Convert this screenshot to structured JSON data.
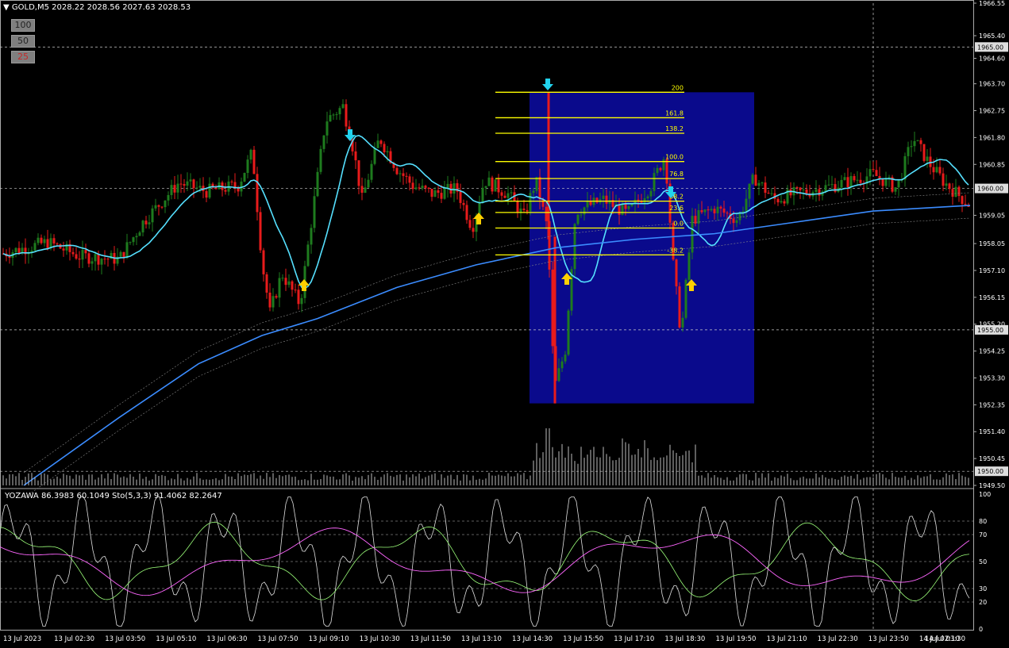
{
  "header": {
    "symbol": "GOLD,M5",
    "ohlc": "2028.22 2028.56 2027.63 2028.53",
    "triangle": "▼"
  },
  "scale_buttons": [
    "100",
    "50",
    "25"
  ],
  "indicator_header": {
    "yozawa": "YOZAWA 86.3983 60.1049",
    "sto": "Sto(5,3,3) 91.4062 82.2647"
  },
  "colors": {
    "background": "#000000",
    "bull": "#1e7b1e",
    "bear": "#e81b1b",
    "ma_fast": "#55e0ff",
    "ma_slow": "#3b8cff",
    "fib": "#ffff00",
    "box": "#0a0a8c",
    "arrow_up": "#ffd000",
    "arrow_down": "#22d3ee",
    "grid": "#8a8a8a"
  },
  "chart_data": [
    {
      "type": "candlestick",
      "name": "main",
      "y_axis_ticks": [
        "1966.55",
        "1965.40",
        "1964.60",
        "1963.70",
        "1962.75",
        "1961.80",
        "1960.85",
        "1959.05",
        "1958.05",
        "1957.10",
        "1956.15",
        "1955.20",
        "1954.25",
        "1953.30",
        "1952.35",
        "1951.40",
        "1950.45",
        "1949.50"
      ],
      "ylim": [
        1949.5,
        1966.55
      ],
      "price_labels": [
        "1965.00",
        "1960.00",
        "1955.00",
        "1950.00"
      ],
      "x_tick_labels": [
        "13 Jul 2023",
        "13 Jul 02:30",
        "13 Jul 03:50",
        "13 Jul 05:10",
        "13 Jul 06:30",
        "13 Jul 07:50",
        "13 Jul 09:10",
        "13 Jul 10:30",
        "13 Jul 11:50",
        "13 Jul 13:10",
        "13 Jul 14:30",
        "13 Jul 15:50",
        "13 Jul 17:10",
        "13 Jul 18:30",
        "13 Jul 19:50",
        "13 Jul 21:10",
        "13 Jul 22:30",
        "13 Jul 23:50",
        "14 Jul 02:10",
        "14 Jul 03:30"
      ],
      "fib_levels": [
        {
          "label": "200",
          "value": 1963.4
        },
        {
          "label": "161.8",
          "value": 1962.5
        },
        {
          "label": "138.2",
          "value": 1961.95
        },
        {
          "label": "100.0",
          "value": 1960.95
        },
        {
          "label": "76.8",
          "value": 1960.35
        },
        {
          "label": "38.2",
          "value": 1959.55
        },
        {
          "label": "23.6",
          "value": 1959.15
        },
        {
          "label": "0.0",
          "value": 1958.6
        },
        {
          "label": "-38.2",
          "value": 1957.65
        }
      ],
      "highlight_box": {
        "y_top": 1963.4,
        "y_bottom": 1952.4
      }
    },
    {
      "type": "line",
      "name": "oscillator",
      "y_axis_ticks": [
        "100",
        "80",
        "70",
        "50",
        "30",
        "20",
        "0"
      ],
      "ylim": [
        0,
        100
      ],
      "levels": [
        80,
        70,
        50,
        30,
        20
      ]
    }
  ]
}
